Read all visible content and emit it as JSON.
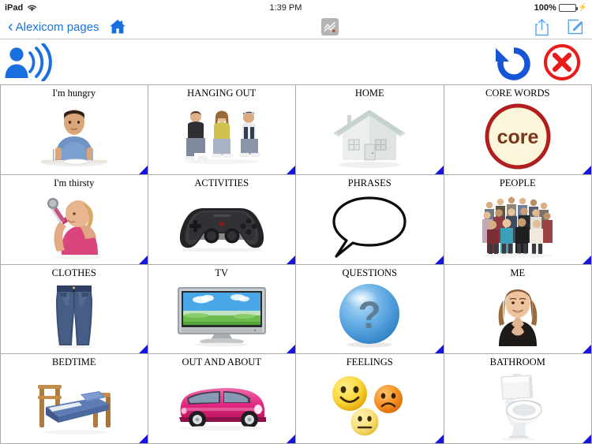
{
  "status_bar": {
    "device": "iPad",
    "wifi_icon": "wifi-icon",
    "time": "1:39 PM",
    "battery_percent": "100%",
    "battery_icon": "battery-icon",
    "charging_icon": "charging-bolt-icon"
  },
  "toolbar": {
    "back_chevron": "‹",
    "back_label": "Alexicom pages",
    "home_icon": "home-icon",
    "chart_icon": "chart-icon",
    "share_icon": "share-icon",
    "compose_icon": "compose-icon"
  },
  "action_row": {
    "speak_icon": "speaker-person-icon",
    "undo_icon": "undo-icon",
    "clear_icon": "clear-close-icon"
  },
  "colors": {
    "accent_blue": "#1574e6",
    "icon_blue": "#1a6fe0",
    "undo_blue": "#1656d6",
    "clear_red": "#e81b1b",
    "corner_blue": "#1515dd",
    "grid_border": "#aaaaaa",
    "battery_green": "#4cd336",
    "core_ring": "#b01e1e",
    "core_fill": "#fbf6d9",
    "core_text": "#7a3418"
  },
  "grid": {
    "columns": 4,
    "rows": 4,
    "cells": [
      {
        "label": "I'm hungry",
        "art": "man-eating-at-table-photo",
        "corner": true
      },
      {
        "label": "HANGING OUT",
        "art": "three-teens-sitting-photo",
        "corner": true
      },
      {
        "label": "HOME",
        "art": "house-illustration",
        "corner": true
      },
      {
        "label": "CORE WORDS",
        "art": "core-words-circle-badge",
        "corner": true
      },
      {
        "label": "I'm thirsty",
        "art": "woman-drinking-bottle-photo",
        "corner": true
      },
      {
        "label": "ACTIVITIES",
        "art": "game-controller-photo",
        "corner": true
      },
      {
        "label": "PHRASES",
        "art": "speech-bubble-outline",
        "corner": true
      },
      {
        "label": "PEOPLE",
        "art": "crowd-of-people-photo",
        "corner": true
      },
      {
        "label": "CLOTHES",
        "art": "blue-jeans-photo",
        "corner": true
      },
      {
        "label": "TV",
        "art": "flatscreen-television-photo",
        "corner": true
      },
      {
        "label": "QUESTIONS",
        "art": "blue-question-mark-orb",
        "corner": true
      },
      {
        "label": "ME",
        "art": "smiling-woman-photo",
        "corner": true
      },
      {
        "label": "BEDTIME",
        "art": "bed-photo",
        "corner": true
      },
      {
        "label": "OUT AND ABOUT",
        "art": "pink-car-photo",
        "corner": true
      },
      {
        "label": "FEELINGS",
        "art": "three-emoji-faces",
        "corner": true
      },
      {
        "label": "BATHROOM",
        "art": "toilet-photo",
        "corner": true
      }
    ]
  }
}
